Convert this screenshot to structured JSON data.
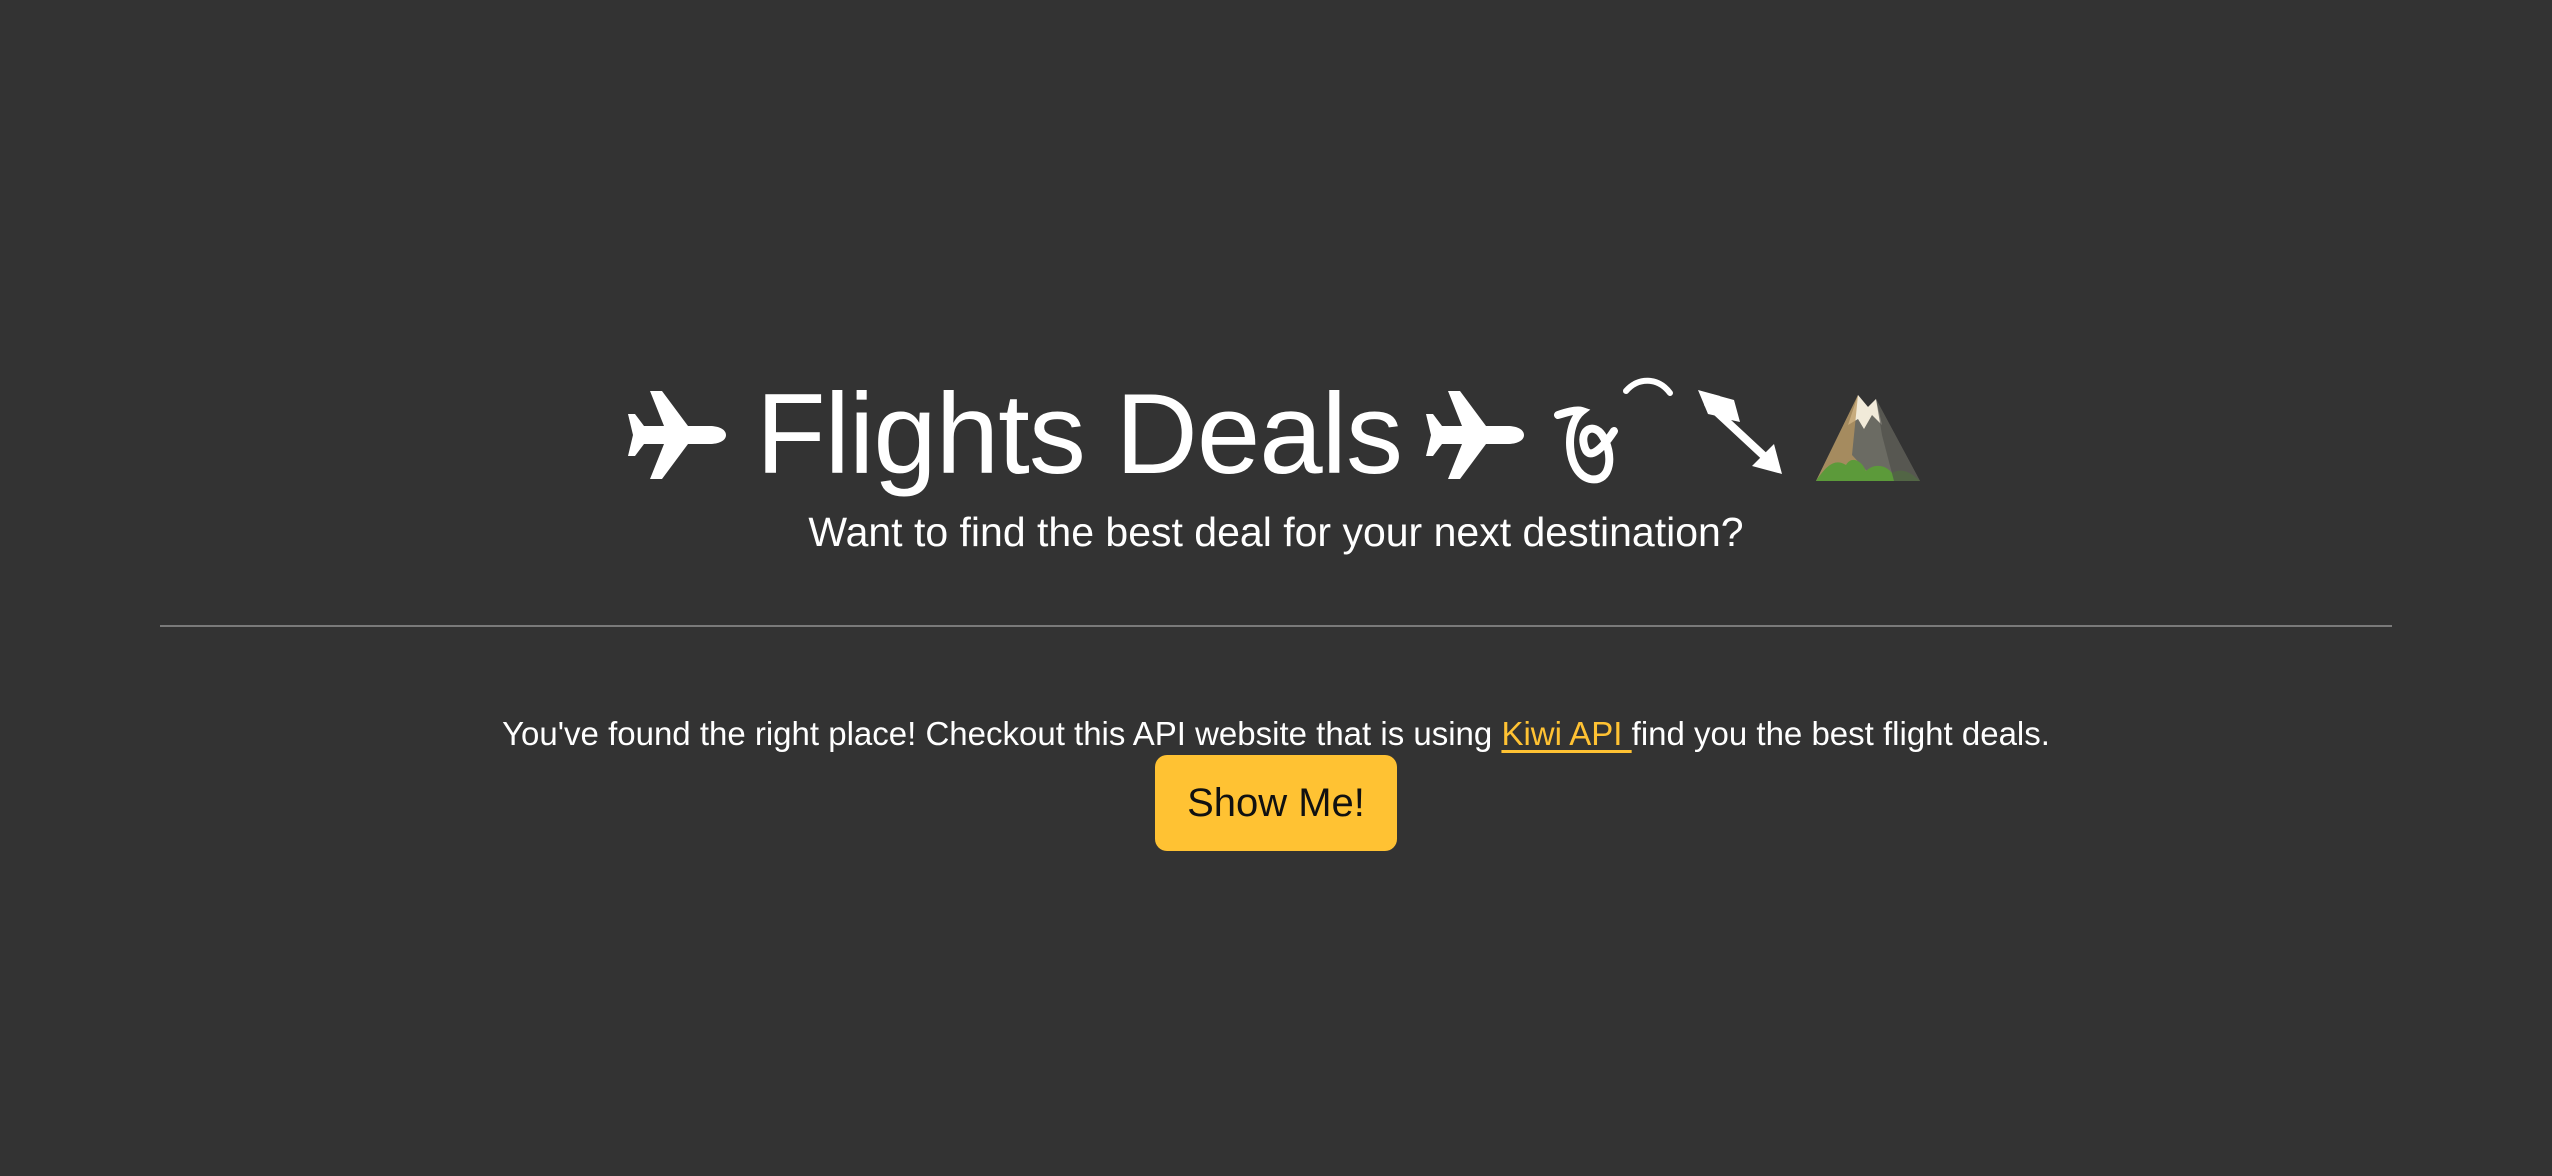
{
  "header": {
    "title": "Flights Deals",
    "icons": [
      "airplane-icon",
      "airplane-icon",
      "loop-arc-icon",
      "arrow-icon",
      "mountain-icon"
    ],
    "subtitle": "Want to find the best deal for your next destination?"
  },
  "main": {
    "lead_before": "You've found the right place! Checkout this API website that is using ",
    "link_text": "Kiwi API ",
    "lead_after": "find you the best flight deals.",
    "button_label": "Show Me!"
  },
  "colors": {
    "background": "#333333",
    "accent": "#ffc233",
    "text": "#ffffff",
    "divider": "#7a7a7a"
  }
}
